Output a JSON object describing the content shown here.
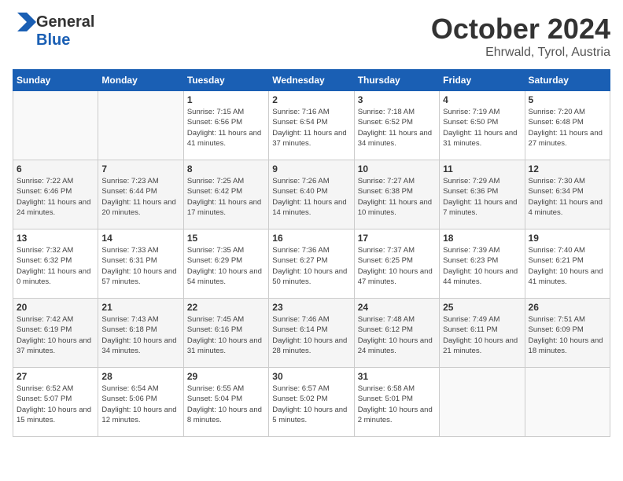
{
  "header": {
    "logo_general": "General",
    "logo_blue": "Blue",
    "month_title": "October 2024",
    "location": "Ehrwald, Tyrol, Austria"
  },
  "days_of_week": [
    "Sunday",
    "Monday",
    "Tuesday",
    "Wednesday",
    "Thursday",
    "Friday",
    "Saturday"
  ],
  "weeks": [
    [
      {
        "day": "",
        "info": ""
      },
      {
        "day": "",
        "info": ""
      },
      {
        "day": "1",
        "sunrise": "Sunrise: 7:15 AM",
        "sunset": "Sunset: 6:56 PM",
        "daylight": "Daylight: 11 hours and 41 minutes."
      },
      {
        "day": "2",
        "sunrise": "Sunrise: 7:16 AM",
        "sunset": "Sunset: 6:54 PM",
        "daylight": "Daylight: 11 hours and 37 minutes."
      },
      {
        "day": "3",
        "sunrise": "Sunrise: 7:18 AM",
        "sunset": "Sunset: 6:52 PM",
        "daylight": "Daylight: 11 hours and 34 minutes."
      },
      {
        "day": "4",
        "sunrise": "Sunrise: 7:19 AM",
        "sunset": "Sunset: 6:50 PM",
        "daylight": "Daylight: 11 hours and 31 minutes."
      },
      {
        "day": "5",
        "sunrise": "Sunrise: 7:20 AM",
        "sunset": "Sunset: 6:48 PM",
        "daylight": "Daylight: 11 hours and 27 minutes."
      }
    ],
    [
      {
        "day": "6",
        "sunrise": "Sunrise: 7:22 AM",
        "sunset": "Sunset: 6:46 PM",
        "daylight": "Daylight: 11 hours and 24 minutes."
      },
      {
        "day": "7",
        "sunrise": "Sunrise: 7:23 AM",
        "sunset": "Sunset: 6:44 PM",
        "daylight": "Daylight: 11 hours and 20 minutes."
      },
      {
        "day": "8",
        "sunrise": "Sunrise: 7:25 AM",
        "sunset": "Sunset: 6:42 PM",
        "daylight": "Daylight: 11 hours and 17 minutes."
      },
      {
        "day": "9",
        "sunrise": "Sunrise: 7:26 AM",
        "sunset": "Sunset: 6:40 PM",
        "daylight": "Daylight: 11 hours and 14 minutes."
      },
      {
        "day": "10",
        "sunrise": "Sunrise: 7:27 AM",
        "sunset": "Sunset: 6:38 PM",
        "daylight": "Daylight: 11 hours and 10 minutes."
      },
      {
        "day": "11",
        "sunrise": "Sunrise: 7:29 AM",
        "sunset": "Sunset: 6:36 PM",
        "daylight": "Daylight: 11 hours and 7 minutes."
      },
      {
        "day": "12",
        "sunrise": "Sunrise: 7:30 AM",
        "sunset": "Sunset: 6:34 PM",
        "daylight": "Daylight: 11 hours and 4 minutes."
      }
    ],
    [
      {
        "day": "13",
        "sunrise": "Sunrise: 7:32 AM",
        "sunset": "Sunset: 6:32 PM",
        "daylight": "Daylight: 11 hours and 0 minutes."
      },
      {
        "day": "14",
        "sunrise": "Sunrise: 7:33 AM",
        "sunset": "Sunset: 6:31 PM",
        "daylight": "Daylight: 10 hours and 57 minutes."
      },
      {
        "day": "15",
        "sunrise": "Sunrise: 7:35 AM",
        "sunset": "Sunset: 6:29 PM",
        "daylight": "Daylight: 10 hours and 54 minutes."
      },
      {
        "day": "16",
        "sunrise": "Sunrise: 7:36 AM",
        "sunset": "Sunset: 6:27 PM",
        "daylight": "Daylight: 10 hours and 50 minutes."
      },
      {
        "day": "17",
        "sunrise": "Sunrise: 7:37 AM",
        "sunset": "Sunset: 6:25 PM",
        "daylight": "Daylight: 10 hours and 47 minutes."
      },
      {
        "day": "18",
        "sunrise": "Sunrise: 7:39 AM",
        "sunset": "Sunset: 6:23 PM",
        "daylight": "Daylight: 10 hours and 44 minutes."
      },
      {
        "day": "19",
        "sunrise": "Sunrise: 7:40 AM",
        "sunset": "Sunset: 6:21 PM",
        "daylight": "Daylight: 10 hours and 41 minutes."
      }
    ],
    [
      {
        "day": "20",
        "sunrise": "Sunrise: 7:42 AM",
        "sunset": "Sunset: 6:19 PM",
        "daylight": "Daylight: 10 hours and 37 minutes."
      },
      {
        "day": "21",
        "sunrise": "Sunrise: 7:43 AM",
        "sunset": "Sunset: 6:18 PM",
        "daylight": "Daylight: 10 hours and 34 minutes."
      },
      {
        "day": "22",
        "sunrise": "Sunrise: 7:45 AM",
        "sunset": "Sunset: 6:16 PM",
        "daylight": "Daylight: 10 hours and 31 minutes."
      },
      {
        "day": "23",
        "sunrise": "Sunrise: 7:46 AM",
        "sunset": "Sunset: 6:14 PM",
        "daylight": "Daylight: 10 hours and 28 minutes."
      },
      {
        "day": "24",
        "sunrise": "Sunrise: 7:48 AM",
        "sunset": "Sunset: 6:12 PM",
        "daylight": "Daylight: 10 hours and 24 minutes."
      },
      {
        "day": "25",
        "sunrise": "Sunrise: 7:49 AM",
        "sunset": "Sunset: 6:11 PM",
        "daylight": "Daylight: 10 hours and 21 minutes."
      },
      {
        "day": "26",
        "sunrise": "Sunrise: 7:51 AM",
        "sunset": "Sunset: 6:09 PM",
        "daylight": "Daylight: 10 hours and 18 minutes."
      }
    ],
    [
      {
        "day": "27",
        "sunrise": "Sunrise: 6:52 AM",
        "sunset": "Sunset: 5:07 PM",
        "daylight": "Daylight: 10 hours and 15 minutes."
      },
      {
        "day": "28",
        "sunrise": "Sunrise: 6:54 AM",
        "sunset": "Sunset: 5:06 PM",
        "daylight": "Daylight: 10 hours and 12 minutes."
      },
      {
        "day": "29",
        "sunrise": "Sunrise: 6:55 AM",
        "sunset": "Sunset: 5:04 PM",
        "daylight": "Daylight: 10 hours and 8 minutes."
      },
      {
        "day": "30",
        "sunrise": "Sunrise: 6:57 AM",
        "sunset": "Sunset: 5:02 PM",
        "daylight": "Daylight: 10 hours and 5 minutes."
      },
      {
        "day": "31",
        "sunrise": "Sunrise: 6:58 AM",
        "sunset": "Sunset: 5:01 PM",
        "daylight": "Daylight: 10 hours and 2 minutes."
      },
      {
        "day": "",
        "info": ""
      },
      {
        "day": "",
        "info": ""
      }
    ]
  ]
}
